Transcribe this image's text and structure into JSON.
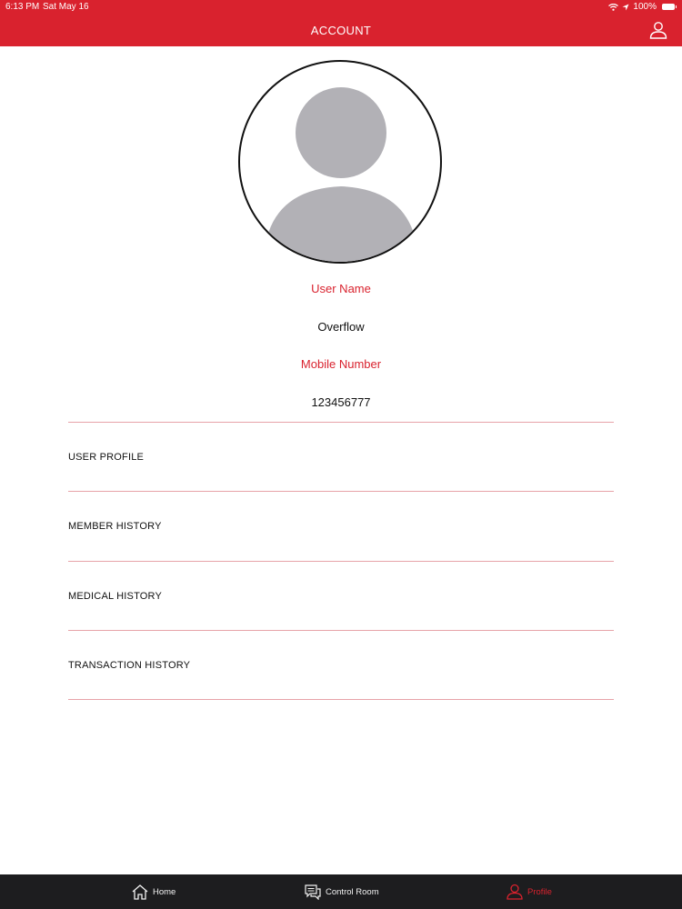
{
  "status_bar": {
    "time": "6:13 PM",
    "date": "Sat May 16",
    "battery": "100%"
  },
  "header": {
    "title": "ACCOUNT",
    "profile_icon": "user-icon",
    "background_color": "#d9222e"
  },
  "profile": {
    "avatar_icon": "default-avatar",
    "username_label": "User Name",
    "username_value": "Overflow",
    "mobile_label": "Mobile Number",
    "mobile_value": "123456777"
  },
  "menu": {
    "items": [
      {
        "label": "USER PROFILE"
      },
      {
        "label": "MEMBER HISTORY"
      },
      {
        "label": "MEDICAL HISTORY"
      },
      {
        "label": "TRANSACTION HISTORY"
      }
    ]
  },
  "tab_bar": {
    "tabs": [
      {
        "label": "Home",
        "icon": "home-icon",
        "active": false
      },
      {
        "label": "Control Room",
        "icon": "chat-icon",
        "active": false
      },
      {
        "label": "Profile",
        "icon": "user-icon",
        "active": true
      }
    ],
    "active_color": "#d9222e"
  }
}
